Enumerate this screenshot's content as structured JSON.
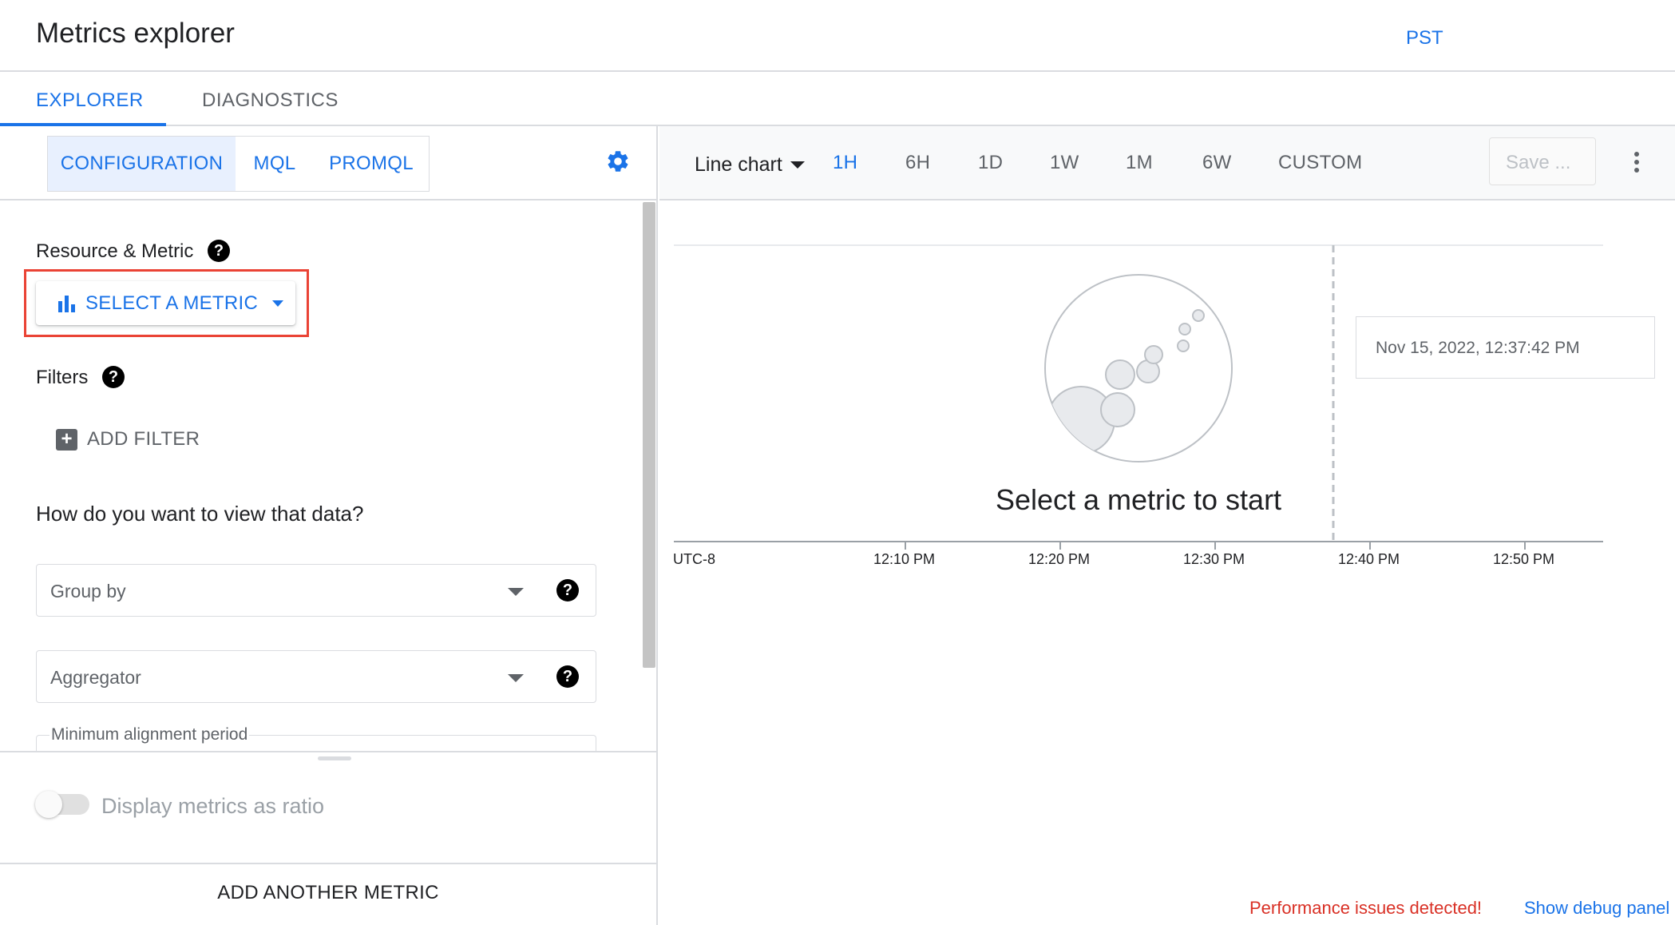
{
  "header": {
    "title": "Metrics explorer"
  },
  "tabs": [
    {
      "label": "EXPLORER",
      "active": true
    },
    {
      "label": "DIAGNOSTICS",
      "active": false
    }
  ],
  "modes": [
    {
      "label": "CONFIGURATION",
      "active": true
    },
    {
      "label": "MQL",
      "active": false
    },
    {
      "label": "PROMQL",
      "active": false
    }
  ],
  "config": {
    "resource_metric_label": "Resource & Metric",
    "select_metric_label": "SELECT A METRIC",
    "filters_label": "Filters",
    "add_filter_label": "ADD FILTER",
    "view_question": "How do you want to view that data?",
    "group_by_placeholder": "Group by",
    "aggregator_placeholder": "Aggregator",
    "alignment_label": "Minimum alignment period",
    "ratio_toggle_label": "Display metrics as ratio",
    "ratio_toggle_on": false,
    "add_metric_label": "ADD ANOTHER METRIC"
  },
  "toolbar": {
    "chart_type": "Line chart",
    "ranges": [
      {
        "label": "1H",
        "active": true
      },
      {
        "label": "6H",
        "active": false
      },
      {
        "label": "1D",
        "active": false
      },
      {
        "label": "1W",
        "active": false
      },
      {
        "label": "1M",
        "active": false
      },
      {
        "label": "6W",
        "active": false
      },
      {
        "label": "CUSTOM",
        "active": false
      }
    ],
    "timezone": "PST",
    "save_label": "Save ..."
  },
  "chart": {
    "empty_message": "Select a metric to start",
    "tooltip_time": "Nov 15, 2022, 12:37:42 PM",
    "timezone_label": "UTC-8",
    "x_ticks": [
      "12:10 PM",
      "12:20 PM",
      "12:30 PM",
      "12:40 PM",
      "12:50 PM"
    ]
  },
  "status": {
    "performance_warning": "Performance issues detected!",
    "debug_link": "Show debug panel"
  },
  "colors": {
    "accent": "#1a73e8",
    "highlight": "#ea4335",
    "warning": "#d93025"
  }
}
